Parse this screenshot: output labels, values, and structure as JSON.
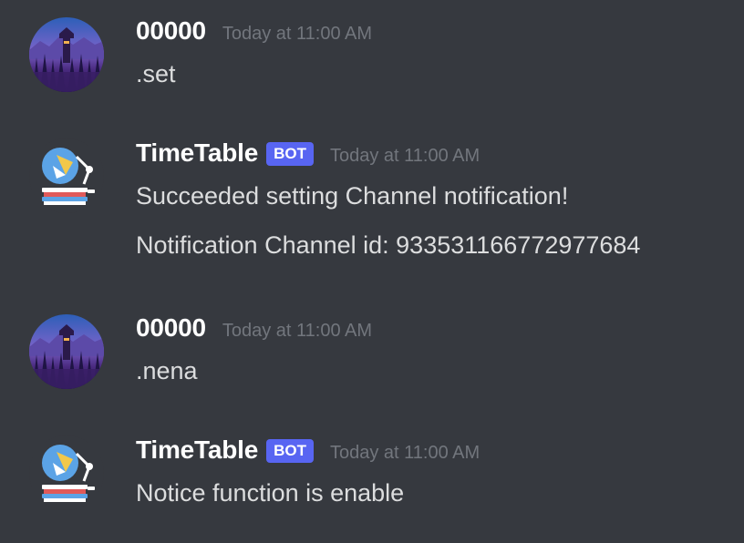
{
  "colors": {
    "background": "#36393f",
    "username": "#ffffff",
    "message_text": "#dcddde",
    "timestamp": "#72767d",
    "bot_badge": "#5865f2"
  },
  "messages": [
    {
      "author": "00000",
      "avatar_icon": "landscape-avatar-icon",
      "timestamp": "Today at 11:00 AM",
      "lines": [
        ".set"
      ]
    },
    {
      "author": "TimeTable",
      "badge": "BOT",
      "avatar_icon": "desk-lamp-books-icon",
      "timestamp": "Today at 11:00 AM",
      "lines": [
        "Succeeded setting Channel notification!",
        "Notification Channel id: 933531166772977684"
      ]
    },
    {
      "author": "00000",
      "avatar_icon": "landscape-avatar-icon",
      "timestamp": "Today at 11:00 AM",
      "lines": [
        ".nena"
      ]
    },
    {
      "author": "TimeTable",
      "badge": "BOT",
      "avatar_icon": "desk-lamp-books-icon",
      "timestamp": "Today at 11:00 AM",
      "lines": [
        "Notice function is enable"
      ]
    }
  ]
}
